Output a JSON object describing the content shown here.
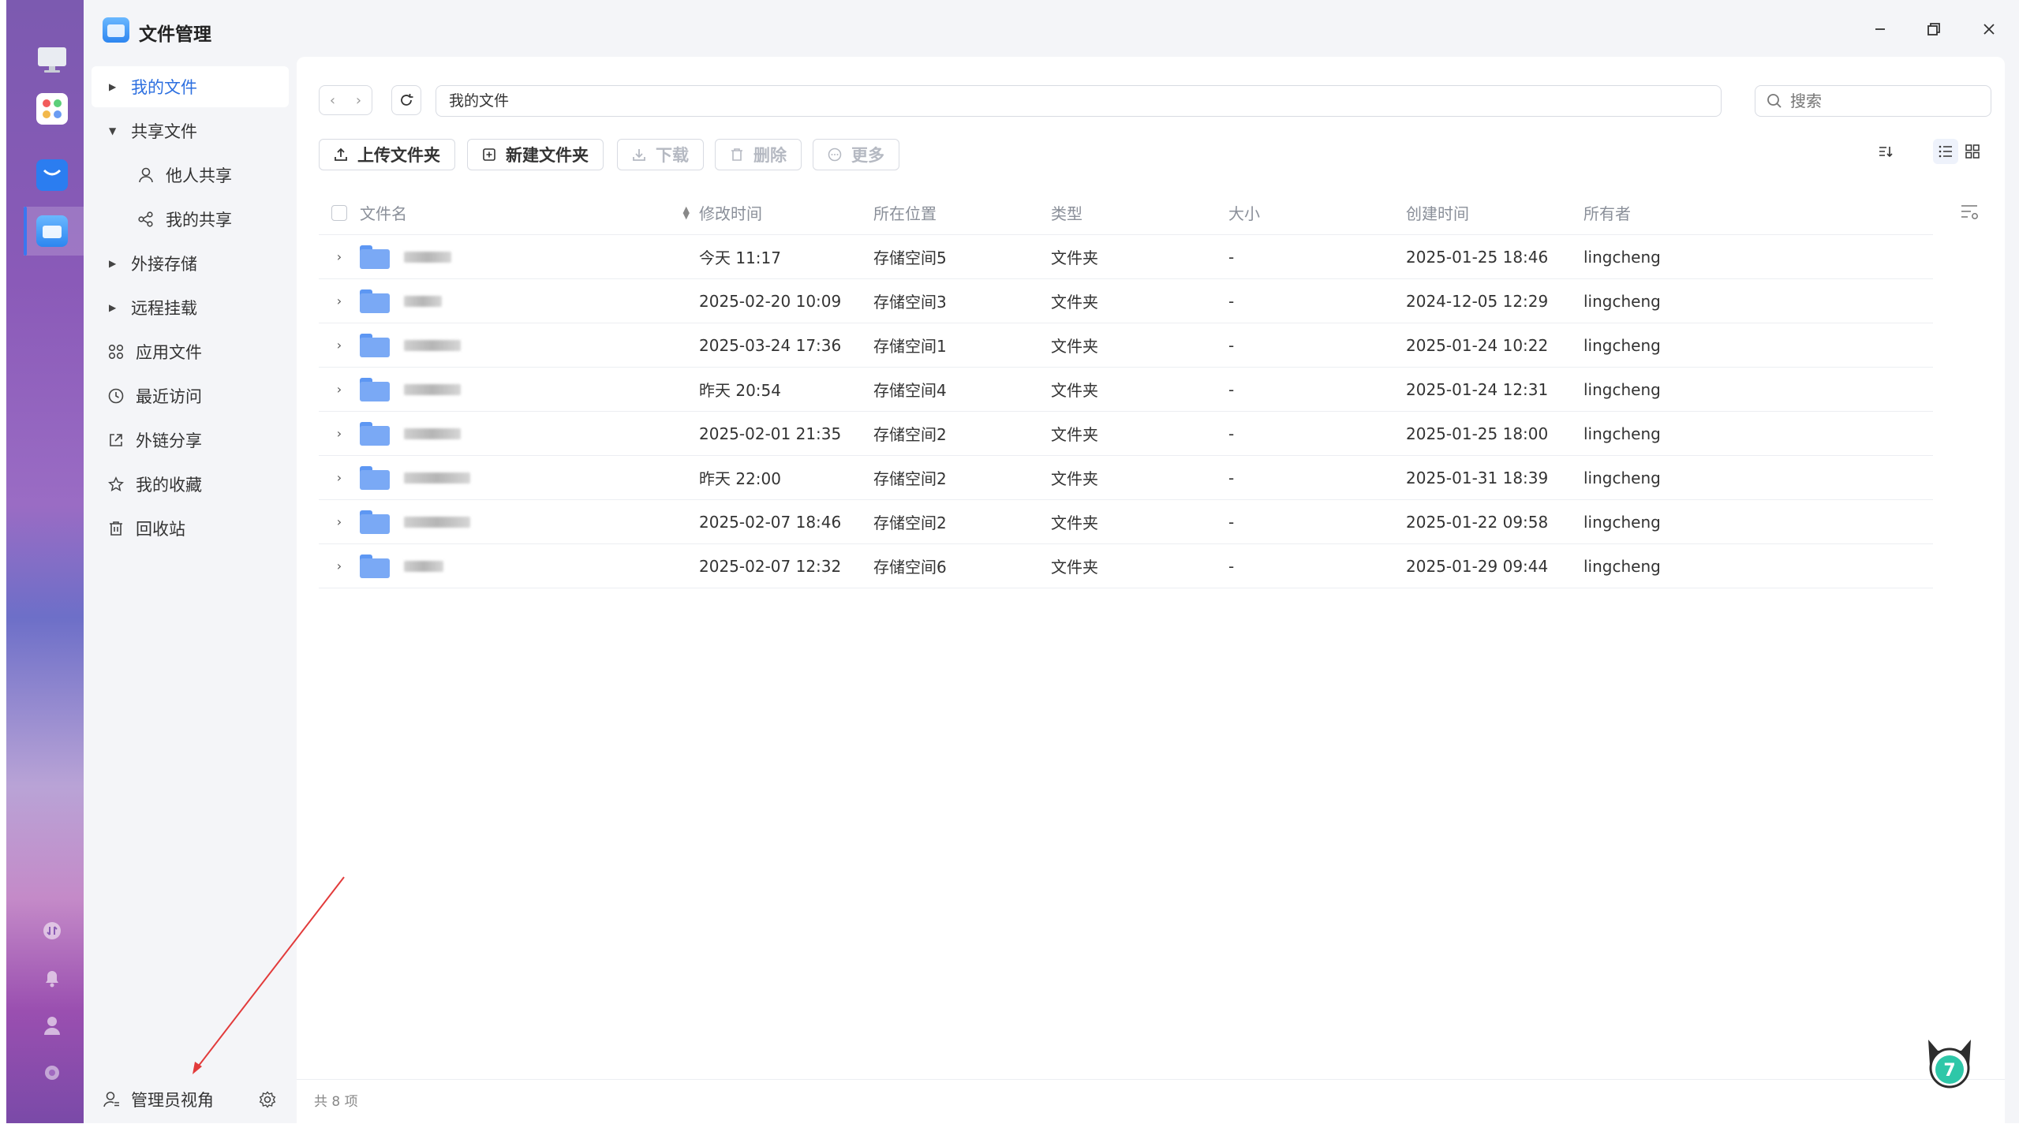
{
  "window": {
    "title": "文件管理"
  },
  "sidebar": {
    "items": [
      {
        "label": "我的文件",
        "active": true
      },
      {
        "label": "共享文件",
        "expanded": true
      },
      {
        "label": "他人共享"
      },
      {
        "label": "我的共享"
      },
      {
        "label": "外接存储"
      },
      {
        "label": "远程挂载"
      },
      {
        "label": "应用文件"
      },
      {
        "label": "最近访问"
      },
      {
        "label": "外链分享"
      },
      {
        "label": "我的收藏"
      },
      {
        "label": "回收站"
      }
    ],
    "footer_label": "管理员视角"
  },
  "toolbar": {
    "path": "我的文件",
    "search_placeholder": "搜索",
    "upload_label": "上传文件夹",
    "new_folder_label": "新建文件夹",
    "download_label": "下载",
    "delete_label": "删除",
    "more_label": "更多"
  },
  "table": {
    "headers": {
      "name": "文件名",
      "mtime": "修改时间",
      "location": "所在位置",
      "type": "类型",
      "size": "大小",
      "ctime": "创建时间",
      "owner": "所有者"
    },
    "rows": [
      {
        "mtime": "今天 11:17",
        "location": "存储空间5",
        "type": "文件夹",
        "size": "-",
        "ctime": "2025-01-25 18:46",
        "owner": "lingcheng"
      },
      {
        "mtime": "2025-02-20 10:09",
        "location": "存储空间3",
        "type": "文件夹",
        "size": "-",
        "ctime": "2024-12-05 12:29",
        "owner": "lingcheng"
      },
      {
        "mtime": "2025-03-24 17:36",
        "location": "存储空间1",
        "type": "文件夹",
        "size": "-",
        "ctime": "2025-01-24 10:22",
        "owner": "lingcheng"
      },
      {
        "mtime": "昨天 20:54",
        "location": "存储空间4",
        "type": "文件夹",
        "size": "-",
        "ctime": "2025-01-24 12:31",
        "owner": "lingcheng"
      },
      {
        "mtime": "2025-02-01 21:35",
        "location": "存储空间2",
        "type": "文件夹",
        "size": "-",
        "ctime": "2025-01-25 18:00",
        "owner": "lingcheng"
      },
      {
        "mtime": "昨天 22:00",
        "location": "存储空间2",
        "type": "文件夹",
        "size": "-",
        "ctime": "2025-01-31 18:39",
        "owner": "lingcheng"
      },
      {
        "mtime": "2025-02-07 18:46",
        "location": "存储空间2",
        "type": "文件夹",
        "size": "-",
        "ctime": "2025-01-22 09:58",
        "owner": "lingcheng"
      },
      {
        "mtime": "2025-02-07 12:32",
        "location": "存储空间6",
        "type": "文件夹",
        "size": "-",
        "ctime": "2025-01-29 09:44",
        "owner": "lingcheng"
      }
    ]
  },
  "status": {
    "count_text": "共 8 项"
  },
  "colors": {
    "accent": "#2c6fe0",
    "folder": "#7aa9f5",
    "sidebar_bg": "#f4f5f8"
  }
}
